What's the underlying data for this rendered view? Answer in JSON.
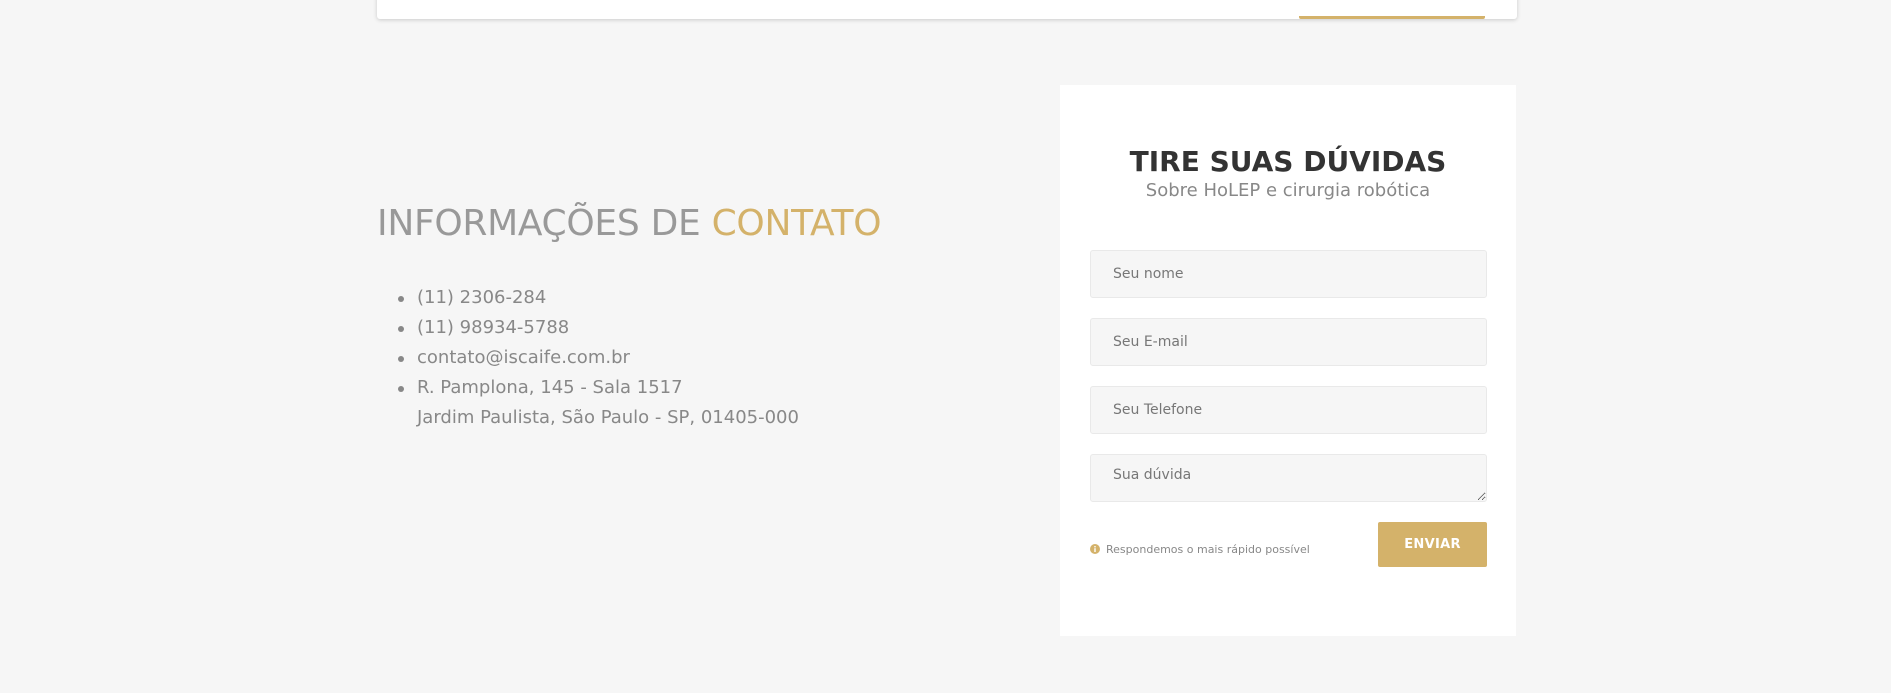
{
  "contact": {
    "title_prefix": "INFORMAÇÕES DE ",
    "title_accent": "CONTATO",
    "items": [
      "(11) 2306-284",
      "(11) 98934-5788",
      "contato@iscaife.com.br"
    ],
    "address_line1": "R. Pamplona, 145 - Sala 1517",
    "address_line2": "Jardim Paulista, São Paulo - SP, 01405-000"
  },
  "form": {
    "title": "TIRE SUAS DÚVIDAS",
    "subtitle": "Sobre HoLEP e cirurgia robótica",
    "fields": {
      "name_placeholder": "Seu nome",
      "email_placeholder": "Seu E-mail",
      "phone_placeholder": "Seu Telefone",
      "question_placeholder": "Sua dúvida"
    },
    "notice": "Respondemos o mais rápido possível",
    "submit_label": "ENVIAR"
  },
  "colors": {
    "accent": "#d4b26a",
    "background": "#f6f6f6",
    "heading": "#333333",
    "muted_text": "#888888"
  },
  "icons": {
    "notice_icon": "info-circle-icon"
  }
}
